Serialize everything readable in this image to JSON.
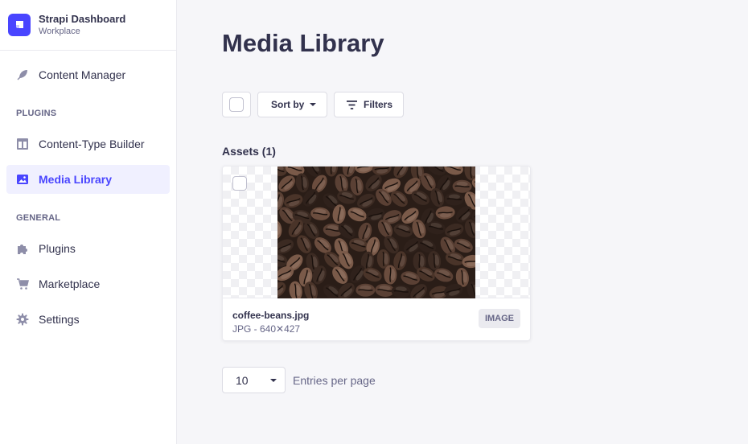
{
  "brand": {
    "title": "Strapi Dashboard",
    "subtitle": "Workplace"
  },
  "sidebar": {
    "content_manager": "Content Manager",
    "plugins_section": "PLUGINS",
    "content_type_builder": "Content-Type Builder",
    "media_library": "Media Library",
    "general_section": "GENERAL",
    "plugins": "Plugins",
    "marketplace": "Marketplace",
    "settings": "Settings"
  },
  "main": {
    "title": "Media Library",
    "sort_label": "Sort by",
    "filters_label": "Filters",
    "assets_heading": "Assets (1)"
  },
  "asset": {
    "name": "coffee-beans.jpg",
    "meta": "JPG - 640✕427",
    "badge": "IMAGE"
  },
  "pagination": {
    "page_size": "10",
    "entries_label": "Entries per page"
  },
  "colors": {
    "accent": "#4945ff",
    "active_bg": "#f0f0ff",
    "background": "#f6f6f9"
  }
}
